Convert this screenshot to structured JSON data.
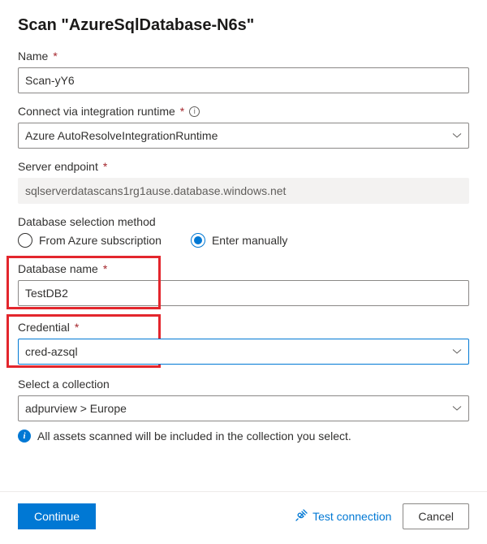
{
  "title": "Scan \"AzureSqlDatabase-N6s\"",
  "fields": {
    "name": {
      "label": "Name",
      "value": "Scan-yY6"
    },
    "runtime": {
      "label": "Connect via integration runtime",
      "value": "Azure AutoResolveIntegrationRuntime"
    },
    "endpoint": {
      "label": "Server endpoint",
      "value": "sqlserverdatascans1rg1ause.database.windows.net"
    },
    "dbmethod": {
      "label": "Database selection method",
      "opt1": "From Azure subscription",
      "opt2": "Enter manually"
    },
    "dbname": {
      "label": "Database name",
      "value": "TestDB2"
    },
    "credential": {
      "label": "Credential",
      "value": "cred-azsql"
    },
    "collection": {
      "label": "Select a collection",
      "value": "adpurview > Europe",
      "info": "All assets scanned will be included in the collection you select."
    }
  },
  "footer": {
    "continue": "Continue",
    "test": "Test connection",
    "cancel": "Cancel"
  }
}
